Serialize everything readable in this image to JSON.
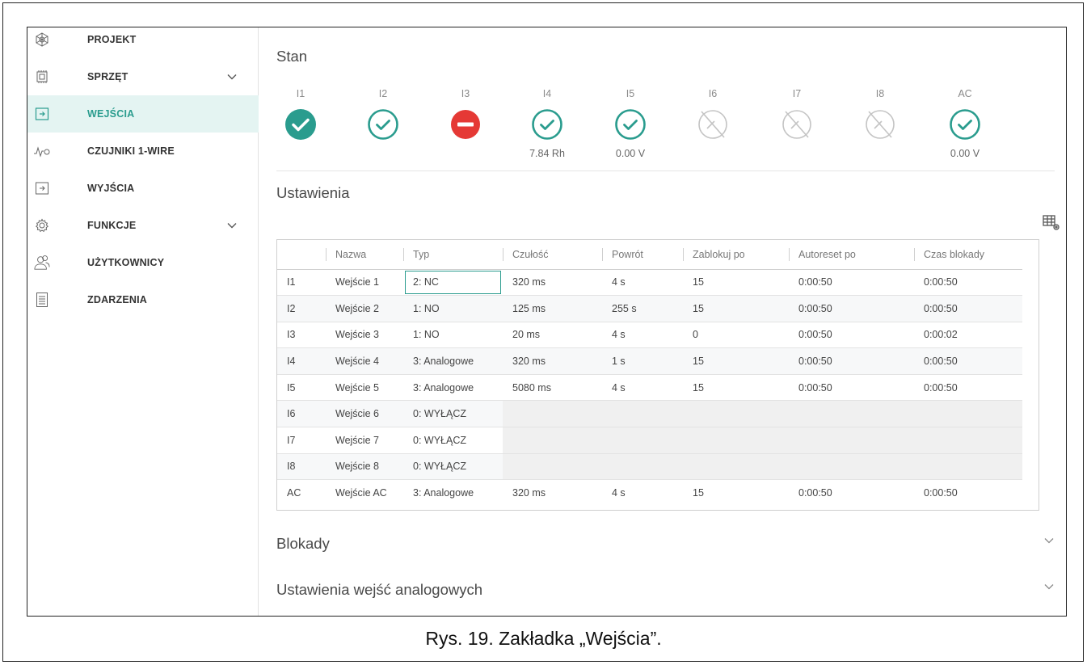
{
  "sidebar": {
    "items": [
      {
        "label": "PROJEKT",
        "icon": "project-icon",
        "active": false,
        "expandable": false
      },
      {
        "label": "SPRZĘT",
        "icon": "hardware-icon",
        "active": false,
        "expandable": true
      },
      {
        "label": "WEJŚCIA",
        "icon": "inputs-icon",
        "active": true,
        "expandable": false
      },
      {
        "label": "CZUJNIKI 1-WIRE",
        "icon": "sensor-icon",
        "active": false,
        "expandable": false
      },
      {
        "label": "WYJŚCIA",
        "icon": "outputs-icon",
        "active": false,
        "expandable": false
      },
      {
        "label": "FUNKCJE",
        "icon": "gear-icon",
        "active": false,
        "expandable": true
      },
      {
        "label": "UŻYTKOWNICY",
        "icon": "users-icon",
        "active": false,
        "expandable": false
      },
      {
        "label": "ZDARZENIA",
        "icon": "events-icon",
        "active": false,
        "expandable": false
      }
    ]
  },
  "stan": {
    "title": "Stan",
    "inputs": [
      {
        "label": "I1",
        "state": "ok-filled",
        "value": ""
      },
      {
        "label": "I2",
        "state": "ok",
        "value": ""
      },
      {
        "label": "I3",
        "state": "blocked",
        "value": ""
      },
      {
        "label": "I4",
        "state": "ok",
        "value": "7.84 Rh"
      },
      {
        "label": "I5",
        "state": "ok",
        "value": "0.00 V"
      },
      {
        "label": "I6",
        "state": "disabled",
        "value": ""
      },
      {
        "label": "I7",
        "state": "disabled",
        "value": ""
      },
      {
        "label": "I8",
        "state": "disabled",
        "value": ""
      },
      {
        "label": "AC",
        "state": "ok",
        "value": "0.00 V"
      }
    ]
  },
  "ustawienia": {
    "title": "Ustawienia",
    "columns": [
      "",
      "Nazwa",
      "Typ",
      "Czułość",
      "Powrót",
      "Zablokuj po",
      "Autoreset po",
      "Czas blokady"
    ],
    "rows": [
      {
        "id": "I1",
        "name": "Wejście 1",
        "type": "2: NC",
        "sens": "320 ms",
        "ret": "4 s",
        "lock": "15",
        "autoreset": "0:00:50",
        "locktime": "0:00:50",
        "off": false
      },
      {
        "id": "I2",
        "name": "Wejście 2",
        "type": "1: NO",
        "sens": "125 ms",
        "ret": "255 s",
        "lock": "15",
        "autoreset": "0:00:50",
        "locktime": "0:00:50",
        "off": false
      },
      {
        "id": "I3",
        "name": "Wejście 3",
        "type": "1: NO",
        "sens": "20 ms",
        "ret": "4 s",
        "lock": "0",
        "autoreset": "0:00:50",
        "locktime": "0:00:02",
        "off": false
      },
      {
        "id": "I4",
        "name": "Wejście 4",
        "type": "3: Analogowe",
        "sens": "320 ms",
        "ret": "1 s",
        "lock": "15",
        "autoreset": "0:00:50",
        "locktime": "0:00:50",
        "off": false
      },
      {
        "id": "I5",
        "name": "Wejście 5",
        "type": "3: Analogowe",
        "sens": "5080 ms",
        "ret": "4 s",
        "lock": "15",
        "autoreset": "0:00:50",
        "locktime": "0:00:50",
        "off": false
      },
      {
        "id": "I6",
        "name": "Wejście 6",
        "type": "0: WYŁĄCZ",
        "sens": "",
        "ret": "",
        "lock": "",
        "autoreset": "",
        "locktime": "",
        "off": true
      },
      {
        "id": "I7",
        "name": "Wejście 7",
        "type": "0: WYŁĄCZ",
        "sens": "",
        "ret": "",
        "lock": "",
        "autoreset": "",
        "locktime": "",
        "off": true
      },
      {
        "id": "I8",
        "name": "Wejście 8",
        "type": "0: WYŁĄCZ",
        "sens": "",
        "ret": "",
        "lock": "",
        "autoreset": "",
        "locktime": "",
        "off": true
      },
      {
        "id": "AC",
        "name": "Wejście AC",
        "type": "3: Analogowe",
        "sens": "320 ms",
        "ret": "4 s",
        "lock": "15",
        "autoreset": "0:00:50",
        "locktime": "0:00:50",
        "off": false
      }
    ]
  },
  "sections": {
    "blokady": "Blokady",
    "analog": "Ustawienia wejść analogowych"
  },
  "caption": "Rys. 19. Zakładka „Wejścia”.",
  "colors": {
    "accent": "#2a9c8e",
    "danger": "#e53935",
    "disabled": "#c4c4c4"
  }
}
